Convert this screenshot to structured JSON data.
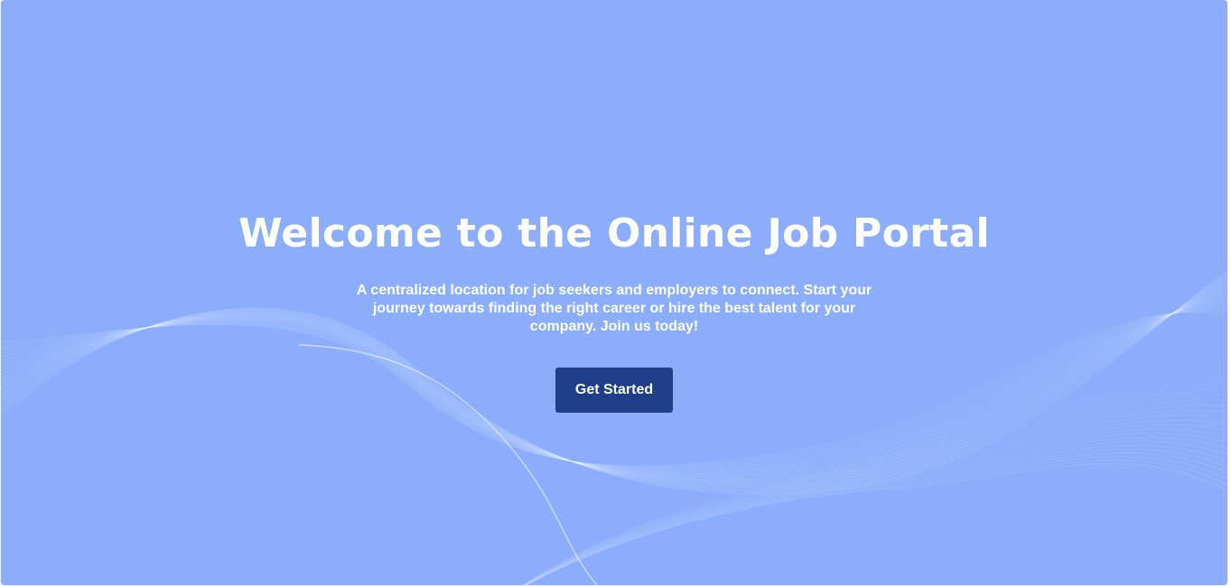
{
  "hero": {
    "title": "Welcome to the Online Job Portal",
    "subtitle": "A centralized location for job seekers and employers to connect. Start your journey towards finding the right career or hire the best talent for your company. Join us today!",
    "cta_label": "Get Started"
  },
  "colors": {
    "background": "#8badfc",
    "button": "#1f3d88",
    "text": "#ffffff",
    "wave_lines": "#ffffff"
  }
}
